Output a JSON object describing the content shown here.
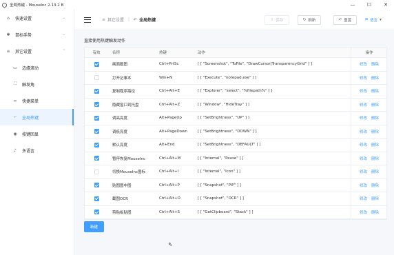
{
  "window": {
    "title": "全局热键 - MouseInc 2.13.2 B",
    "min": "—",
    "max": "☐",
    "close": "✕"
  },
  "sidebar": {
    "items": [
      {
        "label": "快速设置",
        "icon": "home-icon",
        "glyph": "⌂",
        "chevron": "⌄"
      },
      {
        "label": "鼠标手势",
        "icon": "gear-icon",
        "glyph": "✱",
        "chevron": "⌄"
      },
      {
        "label": "其它设置",
        "icon": "sliders-icon",
        "glyph": "≡",
        "chevron": "⌃"
      }
    ],
    "subitems": [
      {
        "label": "边缘滚动",
        "icon": "monitor-icon",
        "glyph": "▭"
      },
      {
        "label": "触发角",
        "icon": "corner-icon",
        "glyph": "⛶"
      },
      {
        "label": "快捷菜单",
        "icon": "link-icon",
        "glyph": "∞"
      },
      {
        "label": "全局热键",
        "icon": "hotkey-icon",
        "glyph": "⌐"
      },
      {
        "label": "按键回显",
        "icon": "eye-icon",
        "glyph": "◉"
      },
      {
        "label": "多语言",
        "icon": "mic-icon",
        "glyph": "♪"
      }
    ]
  },
  "header": {
    "breadcrumb_parent": "其它设置",
    "breadcrumb_current": "全局热键",
    "save_label": "保存",
    "refresh_label": "刷新",
    "reset_label": "重置",
    "language_label": "语言"
  },
  "main": {
    "section_title": "直接使用热键触发动作",
    "add_label": "新建",
    "columns": [
      "有效",
      "名称",
      "热键",
      "动作",
      "操作"
    ],
    "op_edit": "修改",
    "op_delete": "删除",
    "rows": [
      {
        "enabled": true,
        "name": "画面截图",
        "hotkey": "Ctrl+PrtSc",
        "action": "[ [ \"Screenshot\", \"ToFile\", \"DrawCursor|TransparencyGrid\" ] ]"
      },
      {
        "enabled": false,
        "name": "打开记事本",
        "hotkey": "Win+N",
        "action": "[ [ \"Execute\", \"notepad.exe\" ] ]"
      },
      {
        "enabled": true,
        "name": "复制程序路径",
        "hotkey": "Ctrl+Alt+E",
        "action": "[ [ \"Explorer\", \"select\", \"%filepath%\" ] ]"
      },
      {
        "enabled": true,
        "name": "隐藏窗口到托盘",
        "hotkey": "Ctrl+Alt+Z",
        "action": "[ [ \"Window\", \"HideTray\" ] ]"
      },
      {
        "enabled": true,
        "name": "调高亮度",
        "hotkey": "Alt+PageUp",
        "action": "[ [ \"SetBrightness\", \"UP\" ] ]"
      },
      {
        "enabled": true,
        "name": "调低亮度",
        "hotkey": "Alt+PageDown",
        "action": "[ [ \"SetBrightness\", \"DOWN\" ] ]"
      },
      {
        "enabled": true,
        "name": "默认亮度",
        "hotkey": "Alt+End",
        "action": "[ [ \"SetBrightness\", \"DEFAULT\" ] ]"
      },
      {
        "enabled": true,
        "name": "暂停恢复MouseInc",
        "hotkey": "Ctrl+Alt+M",
        "action": "[ [ \"Internal\", \"Pause\" ] ]"
      },
      {
        "enabled": false,
        "name": "切换MouseInc图标",
        "hotkey": "Ctrl+Alt+I",
        "action": "[ [ \"Internal\", \"Icon\" ] ]"
      },
      {
        "enabled": true,
        "name": "贴图图中图",
        "hotkey": "Ctrl+Alt+P",
        "action": "[ [ \"Snapshot\", \"PiP\" ] ]"
      },
      {
        "enabled": true,
        "name": "截图OCR",
        "hotkey": "Ctrl+Alt+O",
        "action": "[ [ \"Snapshot\", \"OCR\" ] ]"
      },
      {
        "enabled": true,
        "name": "剪贴板贴图",
        "hotkey": "Ctrl+Alt+S",
        "action": "[ [ \"GetClipboard\", \"Stack\" ] ]"
      }
    ]
  },
  "colors": {
    "accent": "#409eff",
    "border": "#ebeef5",
    "bg": "#f5f7fa"
  }
}
